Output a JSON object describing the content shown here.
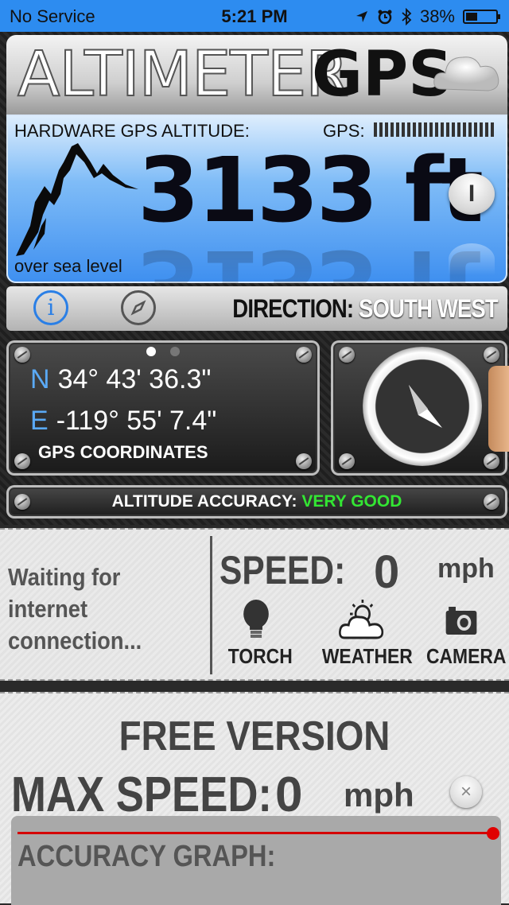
{
  "status_bar": {
    "carrier": "No Service",
    "time": "5:21 PM",
    "battery": "38%",
    "battery_level": 0.38
  },
  "header": {
    "logo_thin": "ALTIMETER",
    "logo_bold": "GPS"
  },
  "altitude": {
    "hardware_label": "HARDWARE GPS ALTITUDE:",
    "gps_label": "GPS:",
    "value": "3133 ft",
    "sea_level_label": "over sea level",
    "unit_button": "I"
  },
  "direction": {
    "label": "DIRECTION:",
    "value": "SOUTH WEST"
  },
  "coordinates": {
    "lat_letter": "N",
    "lat": "34° 43' 36.3\"",
    "lon_letter": "E",
    "lon": "-119° 55' 7.4\"",
    "caption": "GPS COORDINATES"
  },
  "accuracy": {
    "label": "ALTITUDE ACCURACY:",
    "value": "VERY GOOD",
    "value_color": "#33e633"
  },
  "weather_status": "Waiting for\ninternet\nconnection...",
  "speed": {
    "label": "SPEED:",
    "value": "0",
    "unit": "mph"
  },
  "tools": {
    "torch": "TORCH",
    "weather": "WEATHER",
    "camera": "CAMERA"
  },
  "bottom": {
    "free_version": "FREE VERSION",
    "max_speed_label": "MAX SPEED:",
    "max_speed_value": "0",
    "max_speed_unit": "mph",
    "reset_button": "×",
    "graph_label": "ACCURACY GRAPH:"
  },
  "colors": {
    "status_bar": "#2d8cf0",
    "altitude_panel": "#3e8ff0",
    "graph_line": "#d40000"
  }
}
